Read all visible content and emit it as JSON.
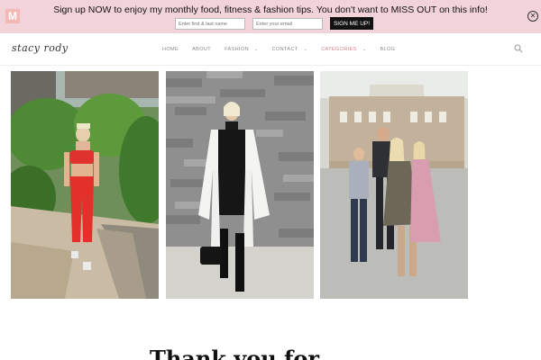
{
  "promo": {
    "logo_letter": "M",
    "text": "Sign up NOW to enjoy my monthly food, fitness & fashion tips. You don't want to MISS OUT on this info!",
    "name_placeholder": "Enter first & last name",
    "email_placeholder": "Enter your email",
    "button_label": "SIGN ME UP!",
    "close_glyph": "✕",
    "background": "#f3d3da"
  },
  "nav": {
    "brand": "stacy rody",
    "items": [
      {
        "label": "HOME",
        "has_dropdown": false
      },
      {
        "label": "ABOUT",
        "has_dropdown": false
      },
      {
        "label": "FASHION",
        "has_dropdown": true
      },
      {
        "label": "CONTACT",
        "has_dropdown": true
      },
      {
        "label": "CATEGORIES",
        "has_dropdown": true
      },
      {
        "label": "BLOG",
        "has_dropdown": false
      }
    ],
    "accent": "#d77d88",
    "search_icon": "search-icon"
  },
  "photos": [
    {
      "subject": "woman in red workout set on tropical stone path"
    },
    {
      "subject": "woman in white coat and black dress against stone wall"
    },
    {
      "subject": "family portrait on city rooftop"
    }
  ],
  "heading": "Thank you for"
}
